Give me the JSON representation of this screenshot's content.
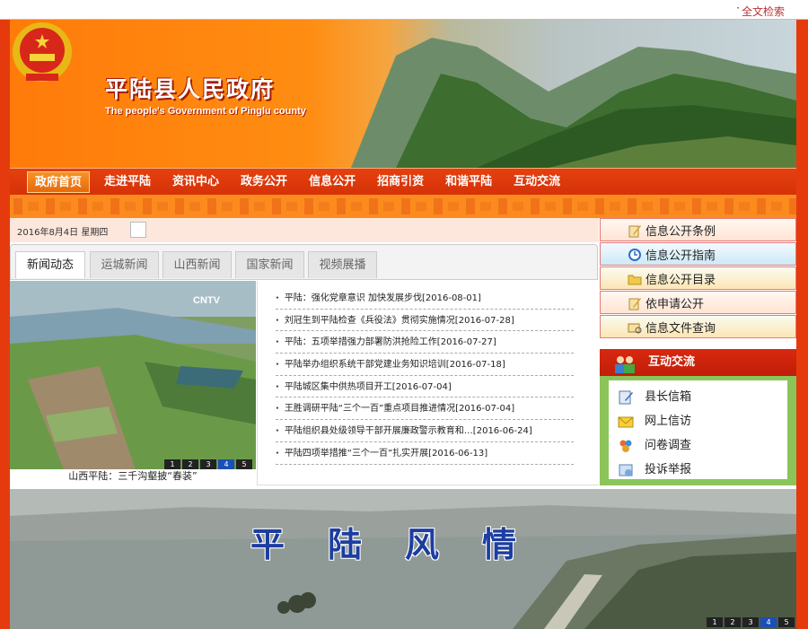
{
  "topbar": {
    "dot": "·",
    "search_label": "全文检索"
  },
  "header": {
    "title": "平陆县人民政府",
    "subtitle": "The people's Government of Pinglu county"
  },
  "nav": {
    "items": [
      "政府首页",
      "走进平陆",
      "资讯中心",
      "政务公开",
      "信息公开",
      "招商引资",
      "和谐平陆",
      "互动交流"
    ]
  },
  "datebar": {
    "date": "2016年8月4日 星期四"
  },
  "tabs": [
    "新闻动态",
    "运城新闻",
    "山西新闻",
    "国家新闻",
    "视频展播"
  ],
  "photo": {
    "caption": "山西平陆：三千沟壑披“春装”",
    "watermark": "CNTV",
    "pager": [
      "1",
      "2",
      "3",
      "4",
      "5"
    ],
    "active_page": "4"
  },
  "news": [
    "平陆：强化党章意识 加快发展步伐[2016-08-01]",
    "刘冠生到平陆检查《兵役法》贯彻实施情况[2016-07-28]",
    "平陆：五项举措强力部署防洪抢险工作[2016-07-27]",
    "平陆举办组织系统干部党建业务知识培训[2016-07-18]",
    "平陆城区集中供热项目开工[2016-07-04]",
    "王胜调研平陆“三个一百”重点项目推进情况[2016-07-04]",
    "平陆组织县处级领导干部开展廉政警示教育和…[2016-06-24]",
    "平陆四项举措推“三个一百”扎实开展[2016-06-13]"
  ],
  "sidebar": {
    "info_links": [
      {
        "label": "信息公开条例",
        "icon": "pencil-doc-icon"
      },
      {
        "label": "信息公开指南",
        "icon": "clock-icon"
      },
      {
        "label": "信息公开目录",
        "icon": "folder-icon"
      },
      {
        "label": "依申请公开",
        "icon": "pencil-doc-icon"
      },
      {
        "label": "信息文件查询",
        "icon": "envelope-search-icon"
      }
    ],
    "hudong": {
      "title": "互动交流",
      "items": [
        {
          "label": "县长信箱",
          "icon": "edit-icon"
        },
        {
          "label": "网上信访",
          "icon": "mail-icon"
        },
        {
          "label": "问卷调查",
          "icon": "group-icon"
        },
        {
          "label": "投诉举报",
          "icon": "complaint-icon"
        }
      ]
    }
  },
  "scenery": {
    "title": "平陆风情",
    "pager": [
      "1",
      "2",
      "3",
      "4",
      "5"
    ],
    "active_page": "4"
  },
  "colors": {
    "brand_red": "#e53a0e",
    "brand_orange": "#ff8d12",
    "accent_blue": "#1a4fb5"
  }
}
